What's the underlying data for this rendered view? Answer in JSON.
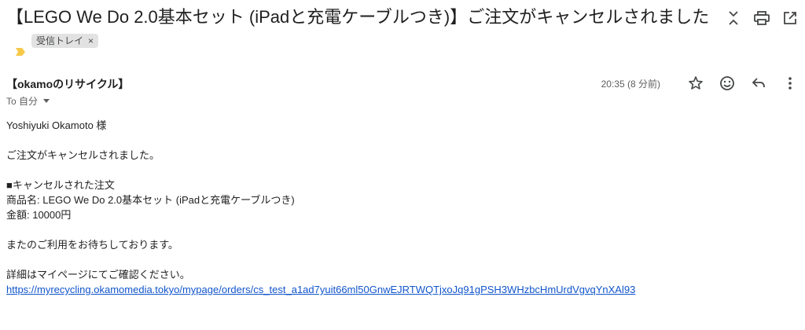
{
  "email": {
    "subject": "【LEGO We Do 2.0基本セット (iPadと充電ケーブルつき)】ご注文がキャンセルされました",
    "label": "受信トレイ",
    "label_remove": "×",
    "sender": "【okamoのリサイクル】",
    "timestamp": "20:35 (8 分前)",
    "to": "To 自分",
    "body": {
      "greeting": "Yoshiyuki Okamoto 様",
      "line1": "ご注文がキャンセルされました。",
      "section_title": "■キャンセルされた注文",
      "product": "商品名: LEGO We Do 2.0基本セット (iPadと充電ケーブルつき)",
      "amount": "金額: 10000円",
      "closing": "またのご利用をお待ちしております。",
      "details": "詳細はマイページにてご確認ください。",
      "link": "https://myrecycling.okamomedia.tokyo/mypage/orders/cs_test_a1ad7yuit66ml50GnwEJRTWQTjxoJq91gPSH3WHzbcHmUrdVgvqYnXAl93"
    }
  },
  "icons": {
    "collapse": "unfold-less-icon",
    "print": "print-icon",
    "new_window": "open-in-new-icon",
    "star": "star-icon",
    "emoji": "emoji-icon",
    "reply": "reply-icon",
    "more": "more-vert-icon",
    "importance": "importance-marker-icon"
  },
  "colors": {
    "importance": "#f7c948",
    "link": "#1155cc",
    "chip_bg": "#e2e2e2"
  }
}
